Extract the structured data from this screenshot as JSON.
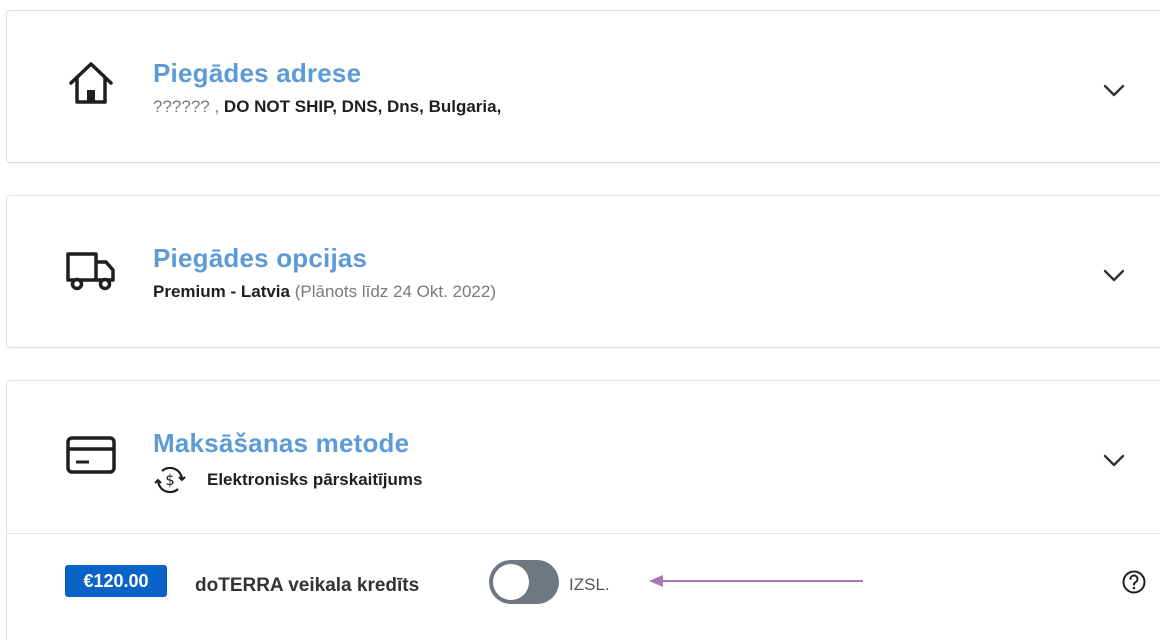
{
  "sections": {
    "address": {
      "title": "Piegādes adrese",
      "placeholder": "?????? ,",
      "value": "DO NOT SHIP, DNS, Dns, Bulgaria,"
    },
    "shipping": {
      "title": "Piegādes opcijas",
      "method": "Premium - Latvia",
      "estimate": "(Plānots līdz 24 Okt. 2022)"
    },
    "payment": {
      "title": "Maksāšanas metode",
      "method": "Elektronisks pārskaitījums"
    }
  },
  "store_credit": {
    "amount": "€120.00",
    "label": "doTERRA veikala kredīts",
    "toggle_state": "IZSL.",
    "enabled": false
  },
  "icons": {
    "address": "home-icon",
    "shipping": "truck-icon",
    "payment": "credit-card-icon",
    "payment_method": "money-transfer-icon",
    "expand": "chevron-down-icon",
    "help": "help-circle-icon"
  },
  "colors": {
    "title": "#5c9bd6",
    "badge": "#0a64c8",
    "toggle_off": "#6f7780",
    "annotation_arrow": "#a678b8"
  }
}
